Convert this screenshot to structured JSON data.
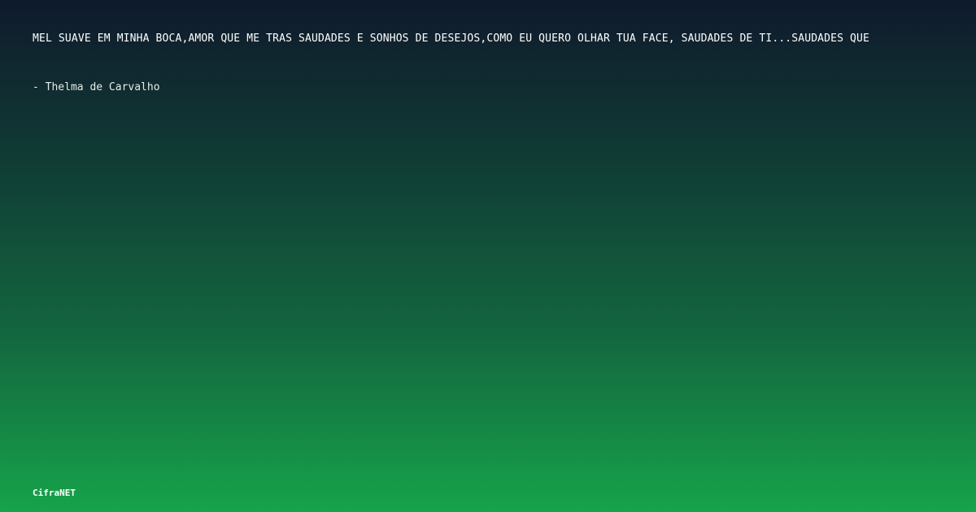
{
  "quote": {
    "text": "MEL SUAVE EM MINHA BOCA,AMOR QUE ME TRAS SAUDADES E SONHOS DE DESEJOS,COMO EU QUERO OLHAR TUA FACE, SAUDADES DE TI...SAUDADES QUE",
    "author": "- Thelma de Carvalho"
  },
  "brand": {
    "name": "CifraNET"
  },
  "colors": {
    "gradient_top": "#0f1a2c",
    "gradient_bottom": "#16a34a",
    "text": "#ffffff"
  }
}
